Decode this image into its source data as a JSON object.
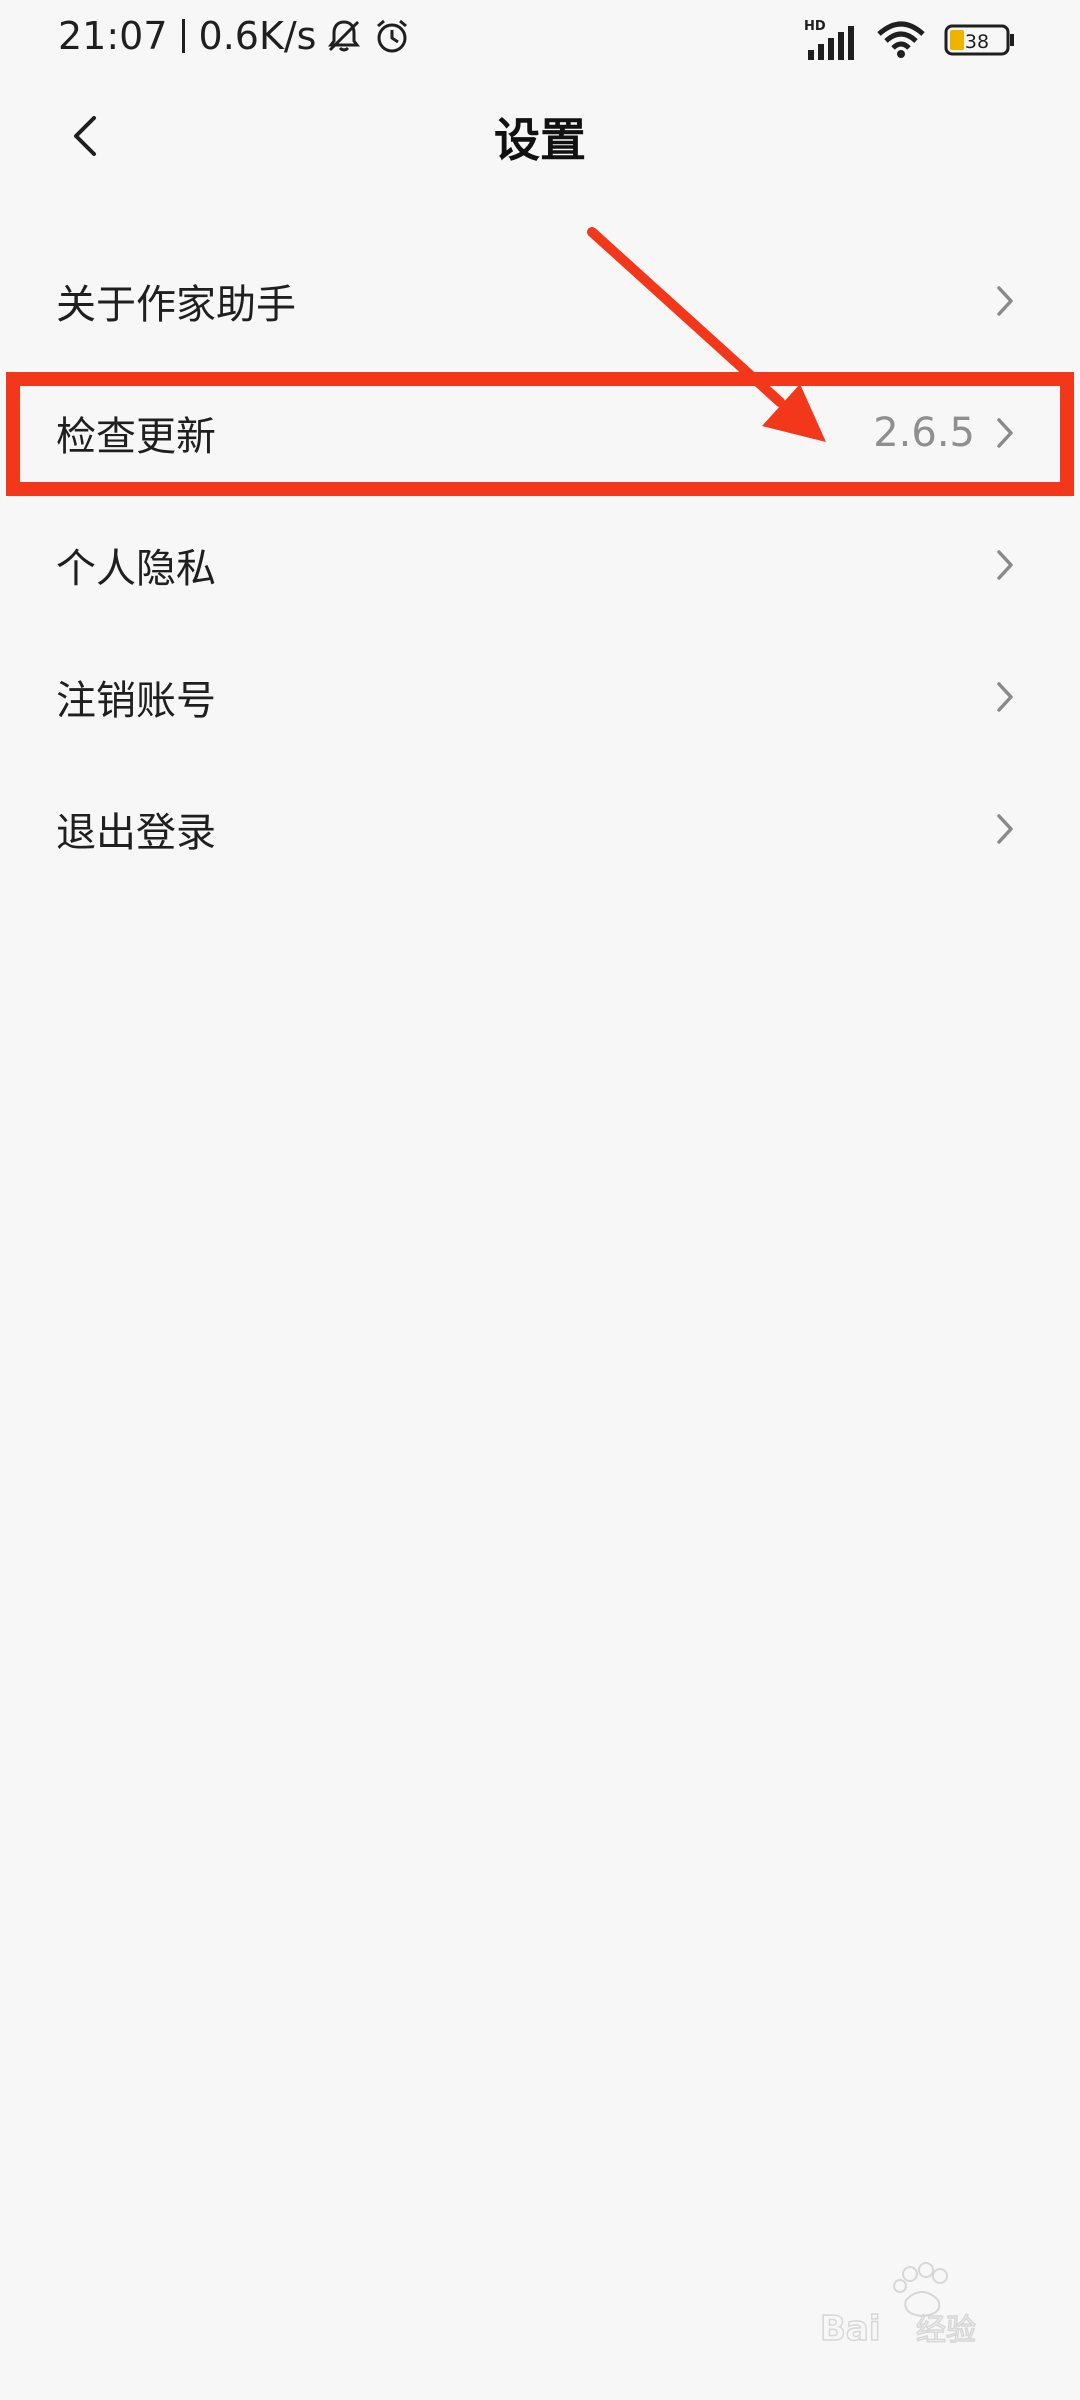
{
  "status_bar": {
    "time": "21:07",
    "network_speed": "0.6K/s",
    "icons": [
      "bell-off-icon",
      "alarm-icon",
      "hd-signal-icon",
      "wifi-icon",
      "battery-icon"
    ],
    "signal_label": "HD",
    "battery_level": "38"
  },
  "header": {
    "back_icon": "chevron-left-icon",
    "title": "设置"
  },
  "settings": {
    "items": [
      {
        "label": "关于作家助手",
        "value": ""
      },
      {
        "label": "检查更新",
        "value": "2.6.5"
      },
      {
        "label": "个人隐私",
        "value": ""
      },
      {
        "label": "注销账号",
        "value": ""
      },
      {
        "label": "退出登录",
        "value": ""
      }
    ]
  },
  "colors": {
    "background": "#f7f7f7",
    "annotation_red": "#f2371b",
    "value_gray": "#8f8f8f",
    "battery_fill": "#f0b400"
  },
  "watermark": {
    "text": "Bai经验"
  }
}
